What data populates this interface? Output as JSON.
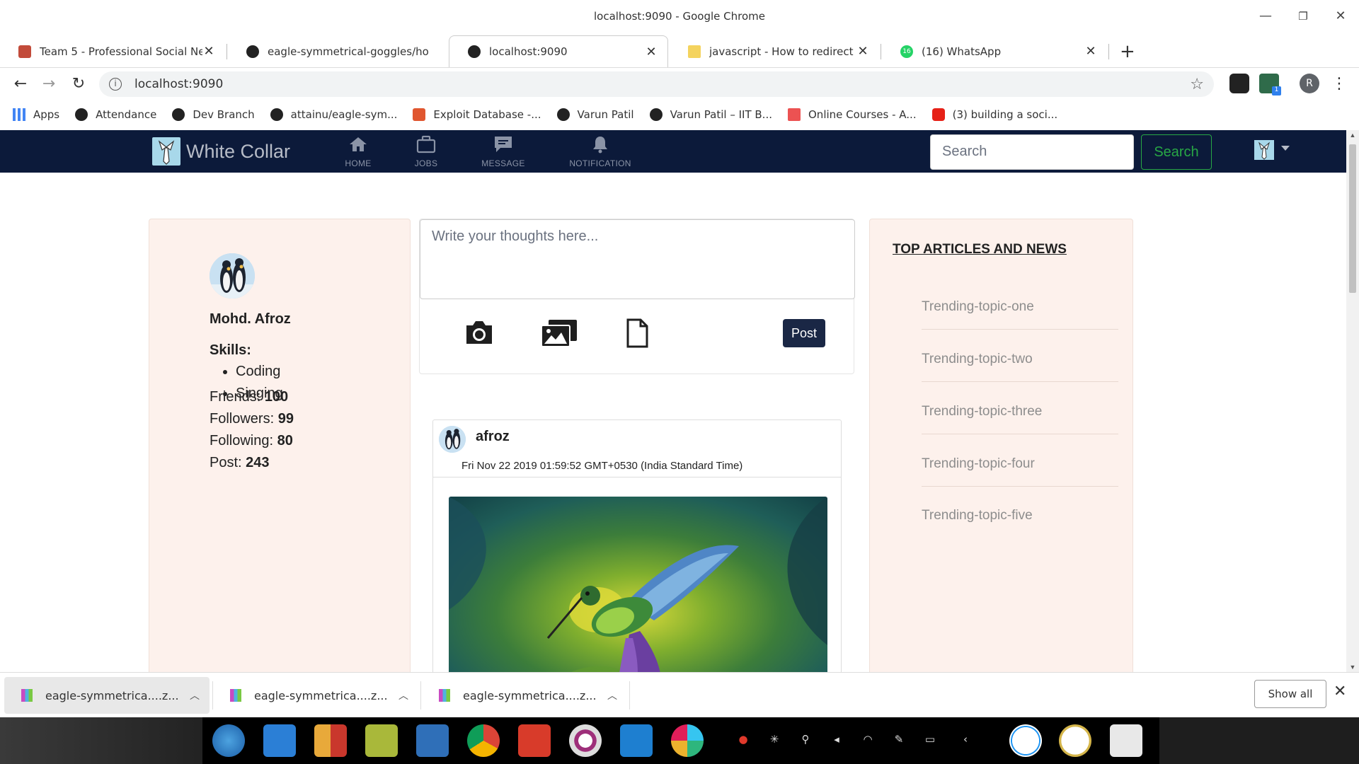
{
  "window": {
    "title": "localhost:9090 - Google Chrome"
  },
  "tabs": [
    {
      "label": "Team 5 - Professional Social Ne",
      "icon": "team-favicon"
    },
    {
      "label": "eagle-symmetrical-goggles/ho",
      "icon": "github-favicon"
    },
    {
      "label": "localhost:9090",
      "icon": "globe-favicon",
      "active": true
    },
    {
      "label": "javascript - How to redirect to a",
      "icon": "stackoverflow-favicon"
    },
    {
      "label": "(16) WhatsApp",
      "icon": "whatsapp-favicon",
      "badge": "16"
    }
  ],
  "address": {
    "url": "localhost:9090"
  },
  "profile_initial": "R",
  "extension_badge": "1",
  "bookmarks": [
    {
      "label": "Apps",
      "icon": "apps-grid-icon"
    },
    {
      "label": "Attendance",
      "icon": "globe-icon"
    },
    {
      "label": "Dev Branch",
      "icon": "github-icon"
    },
    {
      "label": "attainu/eagle-sym...",
      "icon": "github-icon"
    },
    {
      "label": "Exploit Database -...",
      "icon": "exploit-db-icon"
    },
    {
      "label": "Varun Patil",
      "icon": "globe-icon"
    },
    {
      "label": "Varun Patil – IIT B...",
      "icon": "globe-icon"
    },
    {
      "label": "Online Courses - A...",
      "icon": "udemy-icon"
    },
    {
      "label": "(3) building a soci...",
      "icon": "youtube-icon"
    }
  ],
  "app": {
    "brand": "White Collar",
    "nav": [
      {
        "label": "HOME",
        "icon": "home-icon"
      },
      {
        "label": "JOBS",
        "icon": "briefcase-icon"
      },
      {
        "label": "MESSAGE",
        "icon": "message-icon"
      },
      {
        "label": "NOTIFICATION",
        "icon": "bell-icon"
      }
    ],
    "search": {
      "placeholder": "Search",
      "button": "Search"
    }
  },
  "profile": {
    "name": "Mohd. Afroz",
    "skills_heading": "Skills:",
    "skills": [
      "Coding",
      "Singing"
    ],
    "stats": [
      {
        "label": "Friends: ",
        "value": "100"
      },
      {
        "label": "Followers: ",
        "value": "99"
      },
      {
        "label": "Following: ",
        "value": "80"
      },
      {
        "label": "Post: ",
        "value": "243"
      }
    ]
  },
  "composer": {
    "placeholder": "Write your thoughts here...",
    "post_button": "Post"
  },
  "post": {
    "author": "afroz",
    "timestamp": "Fri Nov 22 2019 01:59:52 GMT+0530 (India Standard Time)"
  },
  "news": {
    "heading": "TOP ARTICLES AND NEWS",
    "items": [
      "Trending-topic-one",
      "Trending-topic-two",
      "Trending-topic-three",
      "Trending-topic-four",
      "Trending-topic-five"
    ]
  },
  "downloads": {
    "items": [
      "eagle-symmetrica....z...",
      "eagle-symmetrica....z...",
      "eagle-symmetrica....z..."
    ],
    "show_all": "Show all"
  },
  "colors": {
    "navbar": "#0c1a3a",
    "panel": "#fdf1ec",
    "search_green": "#28a745",
    "post_button": "#1a2745"
  }
}
